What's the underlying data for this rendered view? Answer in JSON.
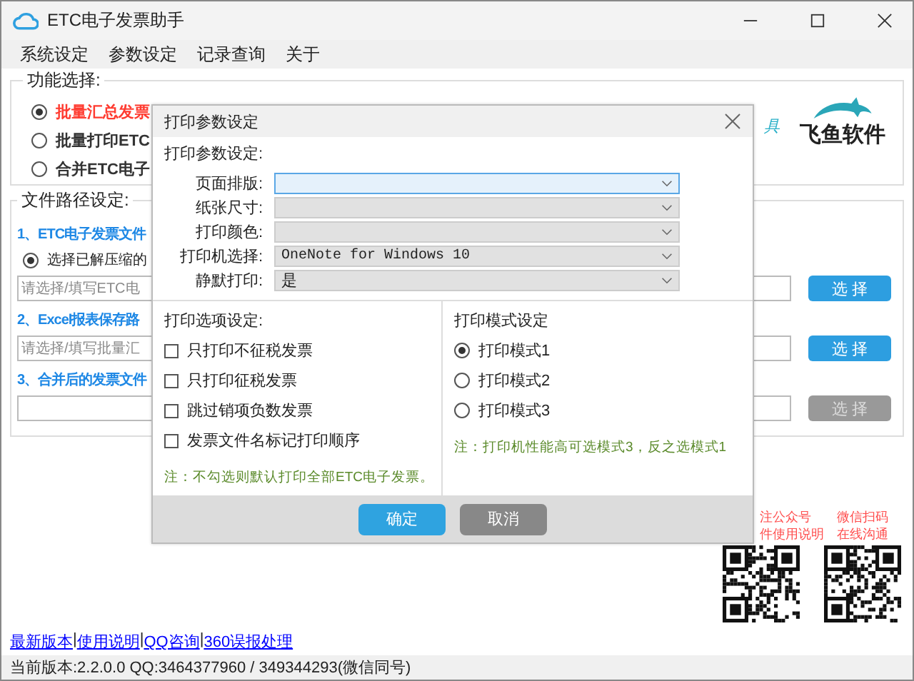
{
  "window": {
    "title": "ETC电子发票助手"
  },
  "menu": [
    {
      "label": "系统设定"
    },
    {
      "label": "参数设定"
    },
    {
      "label": "记录查询"
    },
    {
      "label": "关于"
    }
  ],
  "function_group": {
    "title": "功能选择:",
    "options": [
      {
        "label": "批量汇总发票",
        "selected": true,
        "color": "#ff3b30"
      },
      {
        "label": "批量打印ETC",
        "selected": false,
        "color": "#333333"
      },
      {
        "label": "合并ETC电子",
        "selected": false,
        "color": "#333333"
      }
    ],
    "tagline": "具",
    "logo_text": "飞鱼软件"
  },
  "path_group": {
    "title": "文件路径设定:",
    "sections": [
      {
        "heading": "1、ETC电子发票文件",
        "radio": {
          "label": "选择已解压缩的",
          "selected": true
        },
        "field": {
          "placeholder": "请选择/填写ETC电"
        },
        "button": {
          "label": "选 择",
          "disabled": false
        }
      },
      {
        "heading": "2、Excel报表保存路",
        "field": {
          "placeholder": "请选择/填写批量汇"
        },
        "button": {
          "label": "选 择",
          "disabled": false
        }
      },
      {
        "heading": "3、合并后的发票文件",
        "button": {
          "label": "选 择",
          "disabled": true
        }
      }
    ]
  },
  "qr_codes": [
    {
      "captions": [
        "注公众号",
        "件使用说明"
      ]
    },
    {
      "captions": [
        "微信扫码",
        "在线沟通"
      ]
    }
  ],
  "links": [
    {
      "label": "最新版本"
    },
    {
      "label": "使用说明"
    },
    {
      "label": "QQ咨询"
    },
    {
      "label": "360误报处理"
    }
  ],
  "link_separator": "|",
  "status_bar": "当前版本:2.2.0.0  QQ:3464377960 / 349344293(微信同号)",
  "dialog": {
    "title": "打印参数设定",
    "params_group": {
      "title": "打印参数设定:",
      "rows": [
        {
          "label": "页面排版:",
          "focused": true
        },
        {
          "label": "纸张尺寸:",
          "focused": false
        },
        {
          "label": "打印颜色:",
          "focused": false
        },
        {
          "label": "打印机选择:",
          "value": "OneNote for Windows 10",
          "focused": false
        },
        {
          "label": "静默打印:",
          "value": "是",
          "focused": false
        }
      ]
    },
    "options_group": {
      "title": "打印选项设定:",
      "checks": [
        {
          "label": "只打印不征税发票",
          "checked": false
        },
        {
          "label": "只打印征税发票",
          "checked": false
        },
        {
          "label": "跳过销项负数发票",
          "checked": false
        },
        {
          "label": "发票文件名标记打印顺序",
          "checked": false
        }
      ],
      "note": "注：不勾选则默认打印全部ETC电子发票。"
    },
    "mode_group": {
      "title": "打印模式设定",
      "options": [
        {
          "label": "打印模式1",
          "selected": true
        },
        {
          "label": "打印模式2",
          "selected": false
        },
        {
          "label": "打印模式3",
          "selected": false
        }
      ],
      "note": "注：打印机性能高可选模式3，反之选模式1"
    },
    "buttons": [
      {
        "label": "确定",
        "kind": "primary"
      },
      {
        "label": "取消",
        "kind": "secondary"
      }
    ]
  }
}
